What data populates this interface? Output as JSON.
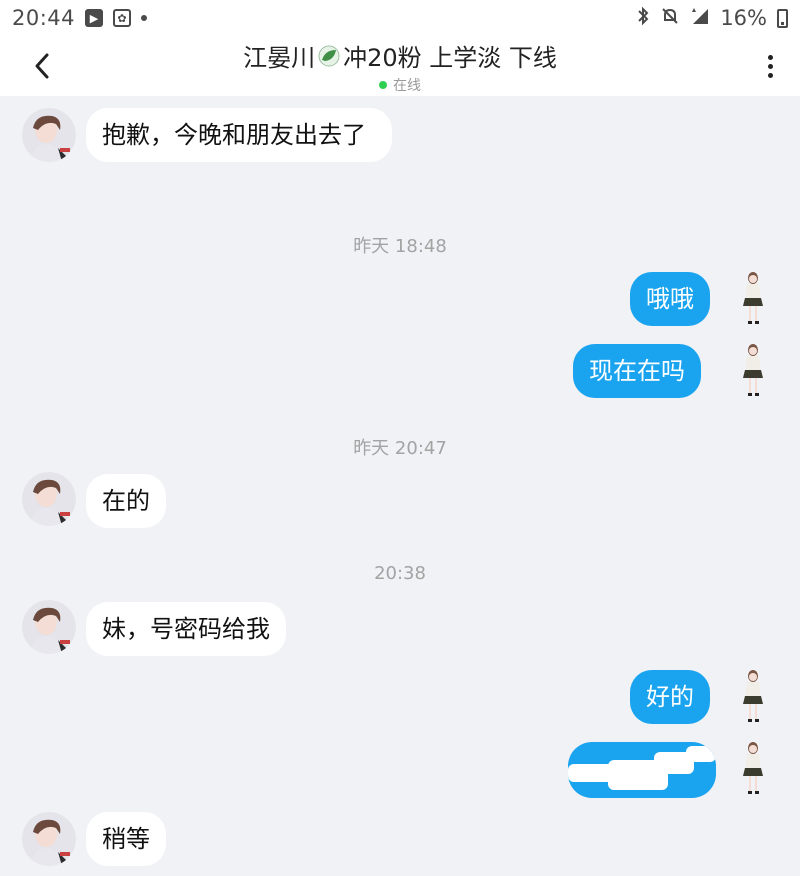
{
  "status_bar": {
    "time": "20:44",
    "battery": "16%",
    "icons": [
      "app-icon",
      "pet-icon",
      "notification-dot",
      "bluetooth-icon",
      "mute-icon",
      "signal-icon",
      "battery-icon"
    ]
  },
  "header": {
    "title_part1": "江晏川",
    "title_part2": "冲20粉 上学淡 下线",
    "status": "在线",
    "colors": {
      "online": "#2fcf52"
    }
  },
  "colors": {
    "outgoing": "#1aa4f0",
    "incoming": "#ffffff",
    "background": "#f1f2f6"
  },
  "messages": [
    {
      "type": "in",
      "text": "抱歉，今晚和朋友出去了"
    },
    {
      "type": "time",
      "text": "昨天 18:48"
    },
    {
      "type": "out",
      "text": "哦哦"
    },
    {
      "type": "out",
      "text": "现在在吗"
    },
    {
      "type": "time",
      "text": "昨天 20:47"
    },
    {
      "type": "in",
      "text": "在的"
    },
    {
      "type": "time",
      "text": "20:38"
    },
    {
      "type": "in",
      "text": "妹，号密码给我"
    },
    {
      "type": "out",
      "text": "好的"
    },
    {
      "type": "out",
      "text": ""
    },
    {
      "type": "in",
      "text": "稍等"
    }
  ]
}
